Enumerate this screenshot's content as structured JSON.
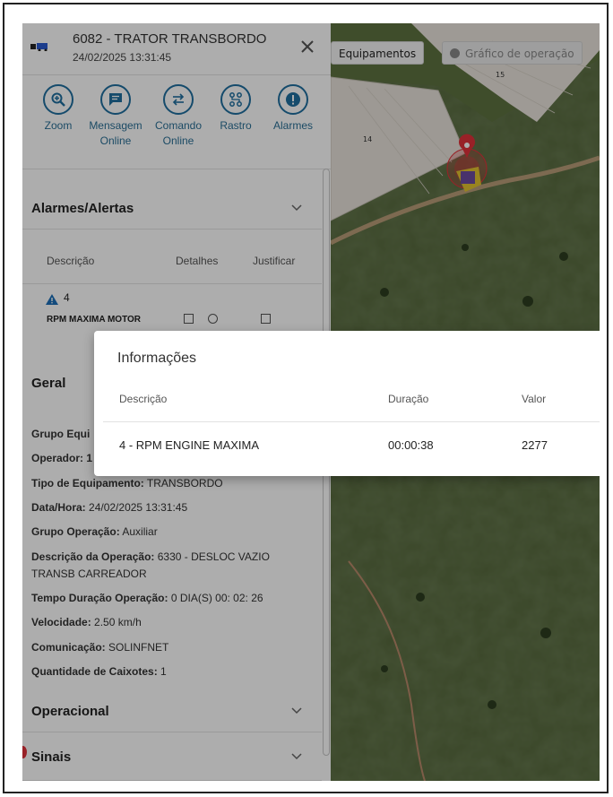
{
  "vehicle": {
    "title": "6082 - TRATOR TRANSBORDO",
    "datetime": "24/02/2025 13:31:45"
  },
  "actions": [
    {
      "label": "Zoom",
      "icon": "zoom-in-icon"
    },
    {
      "label": "Mensagem Online",
      "icon": "message-icon"
    },
    {
      "label": "Comando Online",
      "icon": "swap-arrows-icon"
    },
    {
      "label": "Rastro",
      "icon": "route-icon"
    },
    {
      "label": "Alarmes",
      "icon": "alert-icon"
    }
  ],
  "sections": {
    "alarms": "Alarmes/Alertas",
    "general": "Geral",
    "operational": "Operacional",
    "signals": "Sinais"
  },
  "alarm_table": {
    "headers": [
      "Descrição",
      "Detalhes",
      "Justificar"
    ],
    "row": {
      "code": "4",
      "name": "RPM MAXIMA MOTOR"
    }
  },
  "general_info": {
    "group_label": "Grupo Equi",
    "operator_label": "Operador: 1",
    "equipment_type": {
      "label": "Tipo de Equipamento:",
      "value": "TRANSBORDO"
    },
    "datetime": {
      "label": "Data/Hora:",
      "value": "24/02/2025 13:31:45"
    },
    "operation_group": {
      "label": "Grupo Operação:",
      "value": "Auxiliar"
    },
    "operation_desc": {
      "label": "Descrição da Operação:",
      "value": "6330 - DESLOC VAZIO",
      "value2": "TRANSB CARREADOR"
    },
    "operation_duration": {
      "label": "Tempo Duração Operação:",
      "value": "0 DIA(S) 00: 02: 26"
    },
    "speed": {
      "label": "Velocidade:",
      "value": "2.50 km/h"
    },
    "communication": {
      "label": "Comunicação:",
      "value": "SOLINFNET"
    },
    "boxes": {
      "label": "Quantidade de Caixotes:",
      "value": "1"
    }
  },
  "map": {
    "equipments_button": "Equipamentos",
    "chart_button": "Gráfico de operação",
    "plot_labels": [
      "15",
      "14"
    ]
  },
  "modal": {
    "title": "Informações",
    "headers": [
      "Descrição",
      "Duração",
      "Valor"
    ],
    "row": {
      "description": "4 - RPM ENGINE MAXIMA",
      "duration": "00:00:38",
      "value": "2277"
    }
  },
  "colors": {
    "accent": "#1f6fa0",
    "warning": "#1d6fb8",
    "marker": "#e0313a"
  }
}
